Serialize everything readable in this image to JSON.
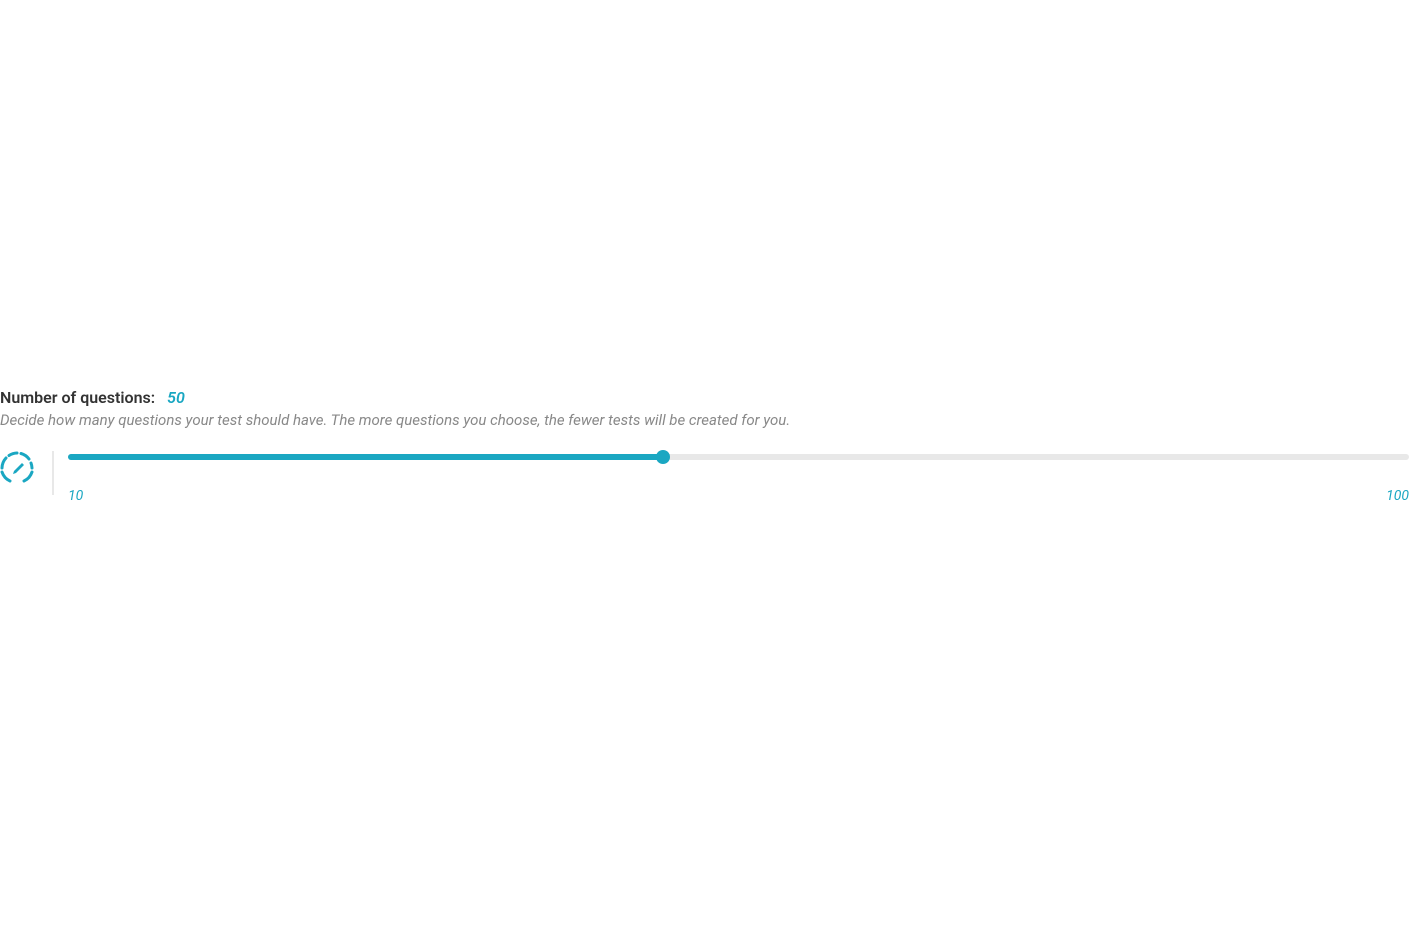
{
  "header": {
    "label": "Number of questions:",
    "value": "50",
    "description": "Decide how many questions your test should have. The more questions you choose, the fewer tests will be created for you."
  },
  "slider": {
    "min_label": "10",
    "max_label": "100",
    "min": 10,
    "max": 100,
    "value": 50
  },
  "colors": {
    "accent": "#1aa7c2",
    "text_primary": "#333333",
    "text_muted": "#888888",
    "track_bg": "#e8e8e8"
  },
  "icon": {
    "name": "speedometer-edit-icon"
  }
}
